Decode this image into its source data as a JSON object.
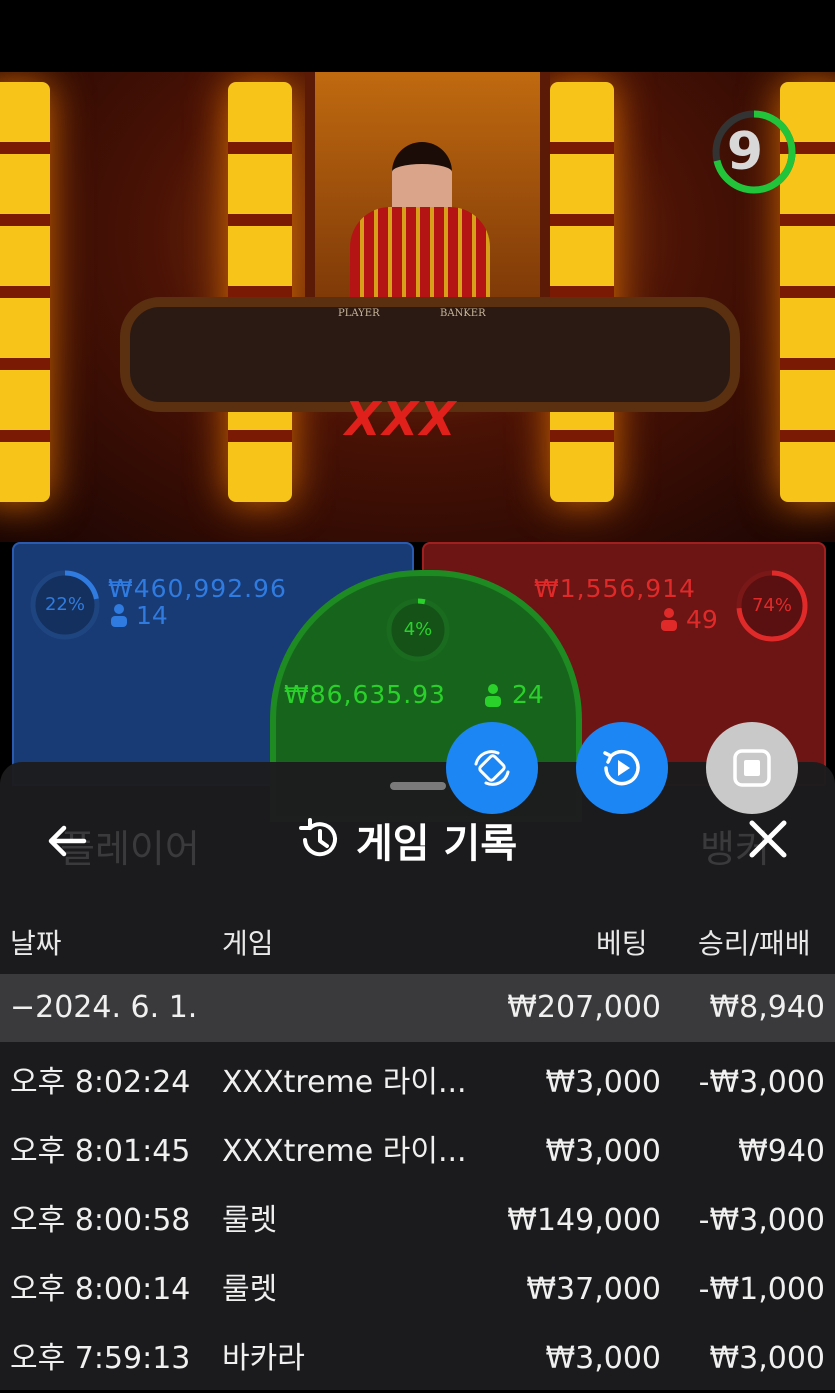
{
  "video": {
    "timer": "9",
    "table_player_label": "PLAYER",
    "table_banker_label": "BANKER",
    "table_logo": "XXX"
  },
  "bets": {
    "player": {
      "percent": "22%",
      "amount": "₩460,992.96",
      "count": "14",
      "color": "#2f7be0"
    },
    "banker": {
      "percent": "74%",
      "amount": "₩1,556,914",
      "count": "49",
      "color": "#e02a2a"
    },
    "tie": {
      "percent": "4%",
      "amount": "₩86,635.93",
      "count": "24",
      "color": "#2bd12b"
    }
  },
  "fabs": [
    {
      "icon": "rotate-screen-icon"
    },
    {
      "icon": "replay-video-icon"
    },
    {
      "icon": "stop-icon"
    }
  ],
  "sheet": {
    "title": "게임 기록",
    "back_icon": "arrow-left-icon",
    "close_icon": "close-icon",
    "history_icon": "history-icon",
    "ghost_left": "플레이어",
    "ghost_right": "뱅커",
    "columns": {
      "date": "날짜",
      "game": "게임",
      "bet": "베팅",
      "result": "승리/패배"
    },
    "summary": {
      "date": "−2024. 6. 1.",
      "bet": "₩207,000",
      "result": "₩8,940"
    },
    "rows": [
      {
        "time": "오후 8:02:24",
        "game": "XXXtreme 라이...",
        "bet": "₩3,000",
        "result": "-₩3,000"
      },
      {
        "time": "오후 8:01:45",
        "game": "XXXtreme 라이...",
        "bet": "₩3,000",
        "result": "₩940"
      },
      {
        "time": "오후 8:00:58",
        "game": "룰렛",
        "bet": "₩149,000",
        "result": "-₩3,000"
      },
      {
        "time": "오후 8:00:14",
        "game": "룰렛",
        "bet": "₩37,000",
        "result": "-₩1,000"
      },
      {
        "time": "오후 7:59:13",
        "game": "바카라",
        "bet": "₩3,000",
        "result": "₩3,000"
      }
    ]
  }
}
